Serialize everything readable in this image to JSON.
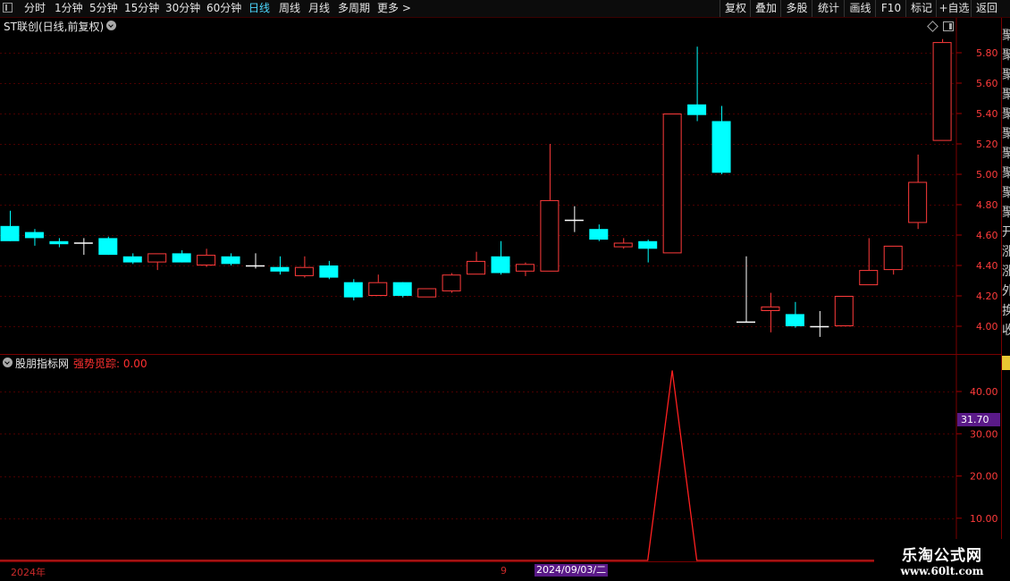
{
  "toolbar": {
    "periods": [
      {
        "label": "分时",
        "active": false
      },
      {
        "label": "1分钟",
        "active": false
      },
      {
        "label": "5分钟",
        "active": false
      },
      {
        "label": "15分钟",
        "active": false
      },
      {
        "label": "30分钟",
        "active": false
      },
      {
        "label": "60分钟",
        "active": false
      },
      {
        "label": "日线",
        "active": true
      },
      {
        "label": "周线",
        "active": false
      },
      {
        "label": "月线",
        "active": false
      },
      {
        "label": "多周期",
        "active": false
      },
      {
        "label": "更多 >",
        "active": false
      }
    ],
    "right_buttons": [
      "复权",
      "叠加",
      "多股",
      "统计",
      "画线",
      "F10",
      "标记",
      "+自选",
      "返回"
    ]
  },
  "main_chart": {
    "title": "ST联创(日线,前复权)",
    "y_axis_ticks": [
      "5.80",
      "5.60",
      "5.40",
      "5.20",
      "5.00",
      "4.80",
      "4.60",
      "4.40",
      "4.20",
      "4.00"
    ]
  },
  "indicator": {
    "name": "股朋指标网",
    "value_label": "强势觅踪: 0.00",
    "y_axis_ticks": [
      "40.00",
      "30.00",
      "20.00",
      "10.00"
    ],
    "cursor_value": "31.70"
  },
  "date_axis": {
    "year": "2024年",
    "month_mark": "9",
    "cursor_date": "2024/09/03/二"
  },
  "watermark": {
    "title": "乐淘公式网",
    "url": "www.60lt.com"
  },
  "edge_glyphs": [
    "聚",
    "聚",
    "聚",
    "聚",
    "聚",
    "聚",
    "聚",
    "聚",
    "聚",
    "聚",
    "开",
    "涨",
    "涨",
    "外",
    "换",
    "收"
  ],
  "colors": {
    "up": "#ff3b3b",
    "down": "#00ffff",
    "grid": "#4a0000",
    "active_tab": "#4dd8ff",
    "cursor_bg": "#5a1a88",
    "indicator_line": "#ff2020"
  },
  "chart_data": [
    {
      "type": "candlestick",
      "title": "ST联创(日线,前复权)",
      "ylim": [
        3.95,
        5.9
      ],
      "candles": [
        {
          "o": 4.66,
          "h": 4.76,
          "l": 4.56,
          "c": 4.56
        },
        {
          "o": 4.62,
          "h": 4.64,
          "l": 4.53,
          "c": 4.58
        },
        {
          "o": 4.56,
          "h": 4.58,
          "l": 4.52,
          "c": 4.54
        },
        {
          "o": 4.55,
          "h": 4.58,
          "l": 4.47,
          "c": 4.55
        },
        {
          "o": 4.58,
          "h": 4.59,
          "l": 4.47,
          "c": 4.47
        },
        {
          "o": 4.46,
          "h": 4.48,
          "l": 4.41,
          "c": 4.42
        },
        {
          "o": 4.42,
          "h": 4.48,
          "l": 4.37,
          "c": 4.48
        },
        {
          "o": 4.48,
          "h": 4.5,
          "l": 4.42,
          "c": 4.42
        },
        {
          "o": 4.4,
          "h": 4.51,
          "l": 4.39,
          "c": 4.47
        },
        {
          "o": 4.46,
          "h": 4.48,
          "l": 4.4,
          "c": 4.41
        },
        {
          "o": 4.4,
          "h": 4.48,
          "l": 4.38,
          "c": 4.4
        },
        {
          "o": 4.39,
          "h": 4.46,
          "l": 4.34,
          "c": 4.36
        },
        {
          "o": 4.33,
          "h": 4.46,
          "l": 4.32,
          "c": 4.39
        },
        {
          "o": 4.4,
          "h": 4.43,
          "l": 4.31,
          "c": 4.32
        },
        {
          "o": 4.29,
          "h": 4.31,
          "l": 4.17,
          "c": 4.19
        },
        {
          "o": 4.2,
          "h": 4.34,
          "l": 4.2,
          "c": 4.29
        },
        {
          "o": 4.29,
          "h": 4.29,
          "l": 4.19,
          "c": 4.2
        },
        {
          "o": 4.19,
          "h": 4.25,
          "l": 4.19,
          "c": 4.25
        },
        {
          "o": 4.23,
          "h": 4.35,
          "l": 4.22,
          "c": 4.34
        },
        {
          "o": 4.34,
          "h": 4.49,
          "l": 4.34,
          "c": 4.43
        },
        {
          "o": 4.46,
          "h": 4.56,
          "l": 4.34,
          "c": 4.35
        },
        {
          "o": 4.36,
          "h": 4.42,
          "l": 4.33,
          "c": 4.41
        },
        {
          "o": 4.36,
          "h": 5.2,
          "l": 4.36,
          "c": 4.83
        },
        {
          "o": 4.7,
          "h": 4.79,
          "l": 4.62,
          "c": 4.7
        },
        {
          "o": 4.64,
          "h": 4.67,
          "l": 4.56,
          "c": 4.57
        },
        {
          "o": 4.52,
          "h": 4.58,
          "l": 4.51,
          "c": 4.55
        },
        {
          "o": 4.56,
          "h": 4.57,
          "l": 4.42,
          "c": 4.51
        },
        {
          "o": 4.48,
          "h": 5.4,
          "l": 4.48,
          "c": 5.4
        },
        {
          "o": 5.46,
          "h": 5.84,
          "l": 5.35,
          "c": 5.39
        },
        {
          "o": 5.35,
          "h": 5.45,
          "l": 5.0,
          "c": 5.01
        },
        {
          "o": 4.03,
          "h": 4.46,
          "l": 4.03,
          "c": 4.03
        },
        {
          "o": 4.1,
          "h": 4.22,
          "l": 3.96,
          "c": 4.13
        },
        {
          "o": 4.08,
          "h": 4.16,
          "l": 3.99,
          "c": 4.0
        },
        {
          "o": 4.0,
          "h": 4.1,
          "l": 3.93,
          "c": 4.0
        },
        {
          "o": 4.0,
          "h": 4.2,
          "l": 4.0,
          "c": 4.2
        },
        {
          "o": 4.27,
          "h": 4.58,
          "l": 4.27,
          "c": 4.37
        },
        {
          "o": 4.37,
          "h": 4.53,
          "l": 4.34,
          "c": 4.53
        },
        {
          "o": 4.68,
          "h": 5.13,
          "l": 4.64,
          "c": 4.95
        },
        {
          "o": 5.22,
          "h": 5.89,
          "l": 5.22,
          "c": 5.87
        }
      ]
    },
    {
      "type": "line",
      "title": "强势觅踪",
      "ylim": [
        0,
        47
      ],
      "values": [
        0,
        0,
        0,
        0,
        0,
        0,
        0,
        0,
        0,
        0,
        0,
        0,
        0,
        0,
        0,
        0,
        0,
        0,
        0,
        0,
        0,
        0,
        0,
        0,
        0,
        0,
        0,
        45,
        0,
        0,
        0,
        0,
        0,
        0,
        0,
        0,
        0,
        0,
        0
      ]
    }
  ]
}
